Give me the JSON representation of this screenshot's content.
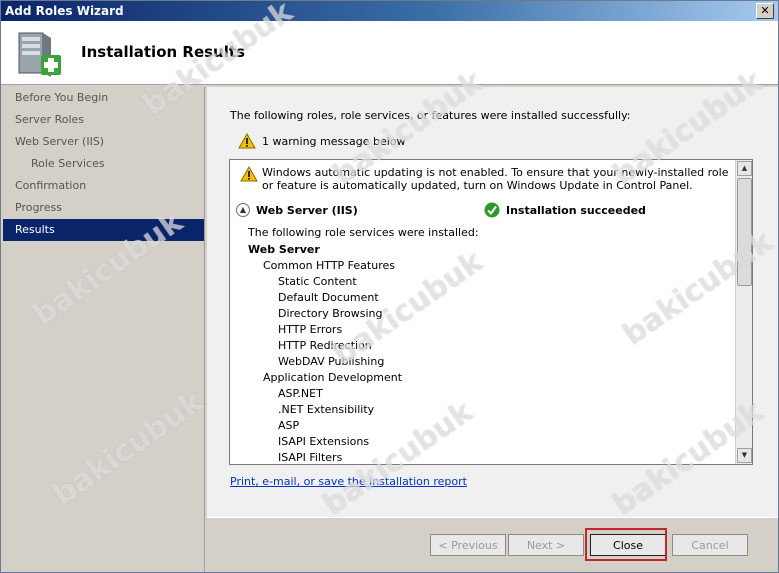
{
  "window": {
    "title": "Add Roles Wizard",
    "close_glyph": "✕"
  },
  "header": {
    "title": "Installation Results",
    "icon": "server-add-icon"
  },
  "nav": {
    "items": [
      {
        "label": "Before You Begin",
        "sub": false,
        "active": false
      },
      {
        "label": "Server Roles",
        "sub": false,
        "active": false
      },
      {
        "label": "Web Server (IIS)",
        "sub": false,
        "active": false
      },
      {
        "label": "Role Services",
        "sub": true,
        "active": false
      },
      {
        "label": "Confirmation",
        "sub": false,
        "active": false
      },
      {
        "label": "Progress",
        "sub": false,
        "active": false
      },
      {
        "label": "Results",
        "sub": false,
        "active": true
      }
    ]
  },
  "main": {
    "intro": "The following roles, role services, or features were installed successfully:",
    "warning_summary": "1 warning message below",
    "box_warning": "Windows automatic updating is not enabled. To ensure that your newly-installed role or feature is automatically updated, turn on Windows Update in Control Panel.",
    "section_name": "Web Server (IIS)",
    "section_status": "Installation succeeded",
    "installed_intro": "The following role services were installed:",
    "tree": [
      {
        "label": "Web Server",
        "level": 0
      },
      {
        "label": "Common HTTP Features",
        "level": 1
      },
      {
        "label": "Static Content",
        "level": 2
      },
      {
        "label": "Default Document",
        "level": 2
      },
      {
        "label": "Directory Browsing",
        "level": 2
      },
      {
        "label": "HTTP Errors",
        "level": 2
      },
      {
        "label": "HTTP Redirection",
        "level": 2
      },
      {
        "label": "WebDAV Publishing",
        "level": 2
      },
      {
        "label": "Application Development",
        "level": 1
      },
      {
        "label": "ASP.NET",
        "level": 2
      },
      {
        "label": ".NET Extensibility",
        "level": 2
      },
      {
        "label": "ASP",
        "level": 2
      },
      {
        "label": "ISAPI Extensions",
        "level": 2
      },
      {
        "label": "ISAPI Filters",
        "level": 2
      }
    ],
    "report_link": "Print, e-mail, or save the installation report"
  },
  "footer": {
    "previous_label": "< Previous",
    "next_label": "Next >",
    "close_label": "Close",
    "cancel_label": "Cancel"
  },
  "watermark": "bakicubuk",
  "colors": {
    "accent": "#0a246a",
    "highlight": "#c0282e",
    "link": "#0033cc",
    "success": "#2f9a2a",
    "warning": "#f2c200"
  }
}
